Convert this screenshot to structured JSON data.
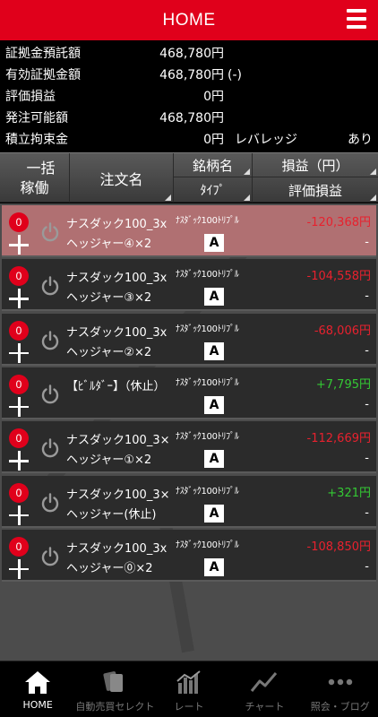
{
  "header": {
    "title": "HOME"
  },
  "summary": {
    "rows": [
      {
        "label": "証拠金預託額",
        "value": "468,780円"
      },
      {
        "label": "有効証拠金額",
        "value": "468,780円",
        "extra": "(-)"
      },
      {
        "label": "評価損益",
        "value": "0円"
      },
      {
        "label": "発注可能額",
        "value": "468,780円"
      },
      {
        "label": "積立拘束金",
        "value": "0円"
      }
    ],
    "leverage_label": "レバレッジ",
    "leverage_value": "あり"
  },
  "columns": {
    "bulk_line1": "一括",
    "bulk_line2": "稼働",
    "order_name": "注文名",
    "brand": "銘柄名",
    "type": "ﾀｲﾌﾟ",
    "pnl": "損益（円）",
    "eval": "評価損益"
  },
  "orders": [
    {
      "count": "0",
      "name1": "ナスダック100_3x",
      "name2": "ヘッジャー④×2",
      "brand": "ﾅｽﾀﾞｯｸ100ﾄﾘﾌﾟﾙ",
      "type": "A",
      "pnl": "-120,368円",
      "eval": "-",
      "sign": "neg",
      "selected": true
    },
    {
      "count": "0",
      "name1": "ナスダック100_3x",
      "name2": "ヘッジャー③×2",
      "brand": "ﾅｽﾀﾞｯｸ100ﾄﾘﾌﾟﾙ",
      "type": "A",
      "pnl": "-104,558円",
      "eval": "-",
      "sign": "neg"
    },
    {
      "count": "0",
      "name1": "ナスダック100_3x",
      "name2": "ヘッジャー②×2",
      "brand": "ﾅｽﾀﾞｯｸ100ﾄﾘﾌﾟﾙ",
      "type": "A",
      "pnl": "-68,006円",
      "eval": "-",
      "sign": "neg"
    },
    {
      "count": "0",
      "name1": "【ﾋﾞﾙﾀﾞｰ】（休止）",
      "name2": "",
      "brand": "ﾅｽﾀﾞｯｸ100ﾄﾘﾌﾟﾙ",
      "type": "A",
      "pnl": "+7,795円",
      "eval": "-",
      "sign": "pos"
    },
    {
      "count": "0",
      "name1": "ナスダック100_3×",
      "name2": "ヘッジャー①×2",
      "brand": "ﾅｽﾀﾞｯｸ100ﾄﾘﾌﾟﾙ",
      "type": "A",
      "pnl": "-112,669円",
      "eval": "-",
      "sign": "neg"
    },
    {
      "count": "0",
      "name1": "ナスダック100_3×",
      "name2": "ヘッジャー(休止)",
      "brand": "ﾅｽﾀﾞｯｸ100ﾄﾘﾌﾟﾙ",
      "type": "A",
      "pnl": "+321円",
      "eval": "-",
      "sign": "pos"
    },
    {
      "count": "0",
      "name1": "ナスダック100_3x",
      "name2": "ヘッジャー⓪×2",
      "brand": "ﾅｽﾀﾞｯｸ100ﾄﾘﾌﾟﾙ",
      "type": "A",
      "pnl": "-108,850円",
      "eval": "-",
      "sign": "neg"
    }
  ],
  "tabs": [
    {
      "label": "HOME",
      "icon": "home-icon",
      "active": true
    },
    {
      "label": "自動売買セレクト",
      "icon": "cards-icon"
    },
    {
      "label": "レート",
      "icon": "rate-chart-icon"
    },
    {
      "label": "チャート",
      "icon": "line-chart-icon"
    },
    {
      "label": "照会・ブログ",
      "icon": "more-dots-icon"
    }
  ],
  "colors": {
    "brand_red": "#e0001b",
    "negative": "#e8212e",
    "positive": "#34c934",
    "selected_row": "#b07072"
  }
}
